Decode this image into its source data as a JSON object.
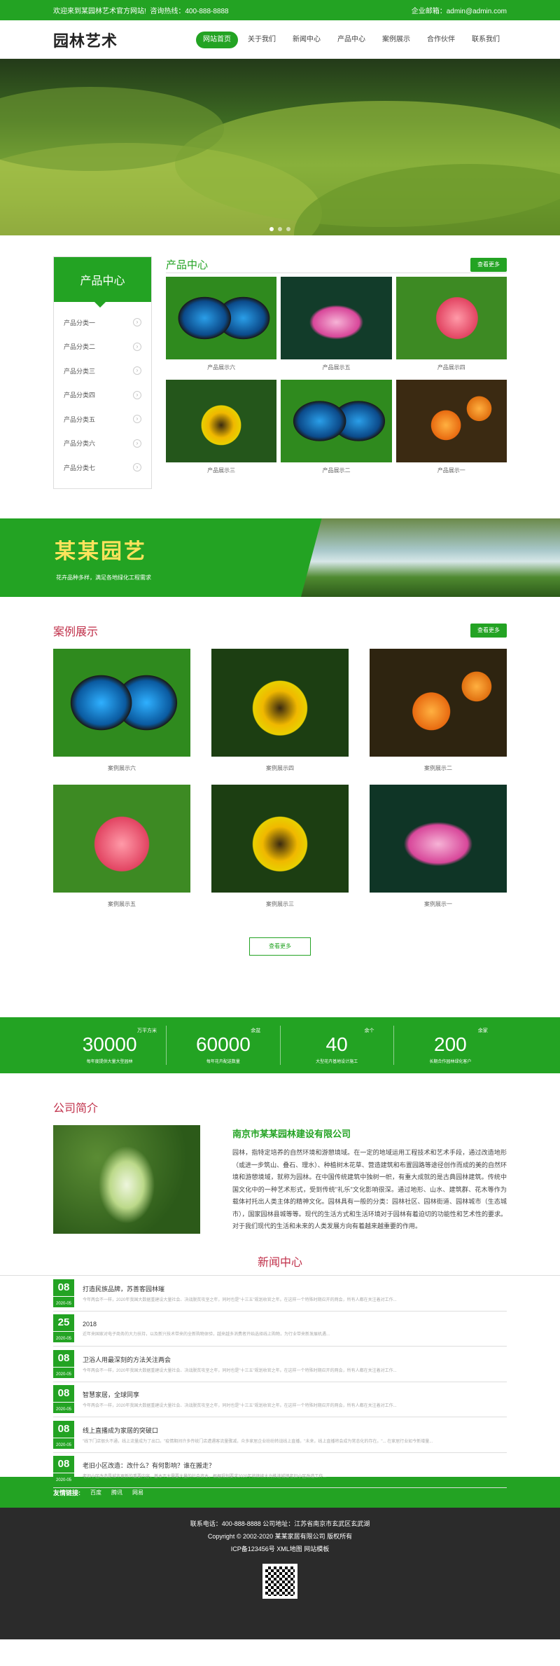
{
  "topbar": {
    "welcome": "欢迎来到某园林艺术官方网站!",
    "phone": "咨询热线：400-888-8888",
    "email": "企业邮箱：admin@admin.com"
  },
  "header": {
    "logo": "园林艺术",
    "nav": [
      "网站首页",
      "关于我们",
      "新闻中心",
      "产品中心",
      "案例展示",
      "合作伙伴",
      "联系我们"
    ]
  },
  "products": {
    "side_title": "产品中心",
    "categories": [
      "产品分类一",
      "产品分类二",
      "产品分类三",
      "产品分类四",
      "产品分类五",
      "产品分类六",
      "产品分类七"
    ],
    "title": "产品中心",
    "more": "查看更多",
    "items": [
      "产品展示六",
      "产品展示五",
      "产品展示四",
      "产品展示三",
      "产品展示二",
      "产品展示一"
    ]
  },
  "slogan": {
    "title": "某某园艺",
    "subtitle": "花卉品种多样，满足各地绿化工程需求"
  },
  "cases": {
    "title": "案例展示",
    "more": "查看更多",
    "items": [
      "案例展示六",
      "案例展示四",
      "案例展示二",
      "案例展示五",
      "案例展示三",
      "案例展示一"
    ],
    "more_button": "查看更多"
  },
  "stats": [
    {
      "num": "30000",
      "unit": "万平方米",
      "desc": "每年度提供大量大型园林"
    },
    {
      "num": "60000",
      "unit": "余盆",
      "desc": "每年花卉配送数量"
    },
    {
      "num": "40",
      "unit": "余个",
      "desc": "大型花卉基地设计施工"
    },
    {
      "num": "200",
      "unit": "余家",
      "desc": "长期合作园林绿化客户"
    }
  ],
  "about": {
    "title": "公司简介",
    "company": "南京市某某园林建设有限公司",
    "text": "园林，指特定培养的自然环境和游憩境域。在一定的地域运用工程技术和艺术手段，通过改造地形（或进一步筑山、叠石、理水）、种植树木花草、营造建筑和布置园路等途径创作而成的美的自然环境和游憩境域，就称为园林。在中国传统建筑中独树一帜，有重大成就的是古典园林建筑。传统中国文化中的一种艺术形式，受到传统\"礼乐\"文化影响很深。通过地形、山水、建筑群、花木等作为载体衬托出人类主体的精神文化。园林具有一般的分类：园林社区、园林街道、园林城市（生态城市），国家园林县城等等。现代的生活方式和生活环境对于园林有着迫切的功能性和艺术性的要求。对于我们现代的生活和未来的人类发展方向有着越来越重要的作用。"
  },
  "news": {
    "title": "新闻中心",
    "items": [
      {
        "day": "08",
        "ym": "2020-05",
        "title": "打造民族品牌，苏善客园林璀",
        "summary": "今年两会不一样，2020年我国大数据重建设大量社会、决战脱贫攻坚之年，同时也是\"十三五\"规划收官之年。在这样一个特殊时期召开的两会，所有人都在关注着对工作..."
      },
      {
        "day": "25",
        "ym": "2020-05",
        "title": "2018",
        "summary": "近年来国家对电子商务的大力扶持，以及新兴技术带来的全新购物体验，越来越多消费者开始选择线上购物，为行业带来新发展机遇..."
      },
      {
        "day": "08",
        "ym": "2020-05",
        "title": "卫浴人用最深刻的方法关注两会",
        "summary": "今年两会不一样，2020年我国大数据重建设大量社会、决战脱贫攻坚之年，同时也是\"十三五\"规划收官之年。在这样一个特殊时期召开的两会，所有人都在关注着对工作..."
      },
      {
        "day": "08",
        "ym": "2020-05",
        "title": "智慧家居，全球同享",
        "summary": "今年两会不一样，2020年我国大数据重建设大量社会、决战脱贫攻坚之年，同时也是\"十三五\"规划收官之年。在这样一个特殊时期召开的两会，所有人都在关注着对工作..."
      },
      {
        "day": "08",
        "ym": "2020-05",
        "title": "线上直播成为家居的突破口",
        "summary": "\"线下门店很头不通，线上流量成为了出口。\"疫情期间许多传统门店遭遇客流量骤减，众多家居企业纷纷转战线上直播，\"未来，线上直播将会成为常态化的存在。\"... 在家居行业如今新增量..."
      },
      {
        "day": "08",
        "ym": "2020-05",
        "title": "老旧小区改造：改什么？有何影响？谁在搬走？",
        "summary": "老旧小区改造是城市更新的重要内容，基本不太需要大量的社会资本，根据规划要求2020年将继续大力推进城镇老旧小区改造工作..."
      }
    ]
  },
  "links": {
    "label": "友情链接:",
    "items": [
      "百度",
      "腾讯",
      "网易"
    ]
  },
  "footer": {
    "contact": "联系电话：400-888-8888 公司地址：江苏省南京市玄武区玄武湖",
    "copyright": "Copyright © 2002-2020 某某家居有限公司 版权所有",
    "icp": "ICP备123456号 XML地图 网站模板"
  },
  "colors": {
    "primary": "#23a323",
    "accent": "#c0304a"
  }
}
